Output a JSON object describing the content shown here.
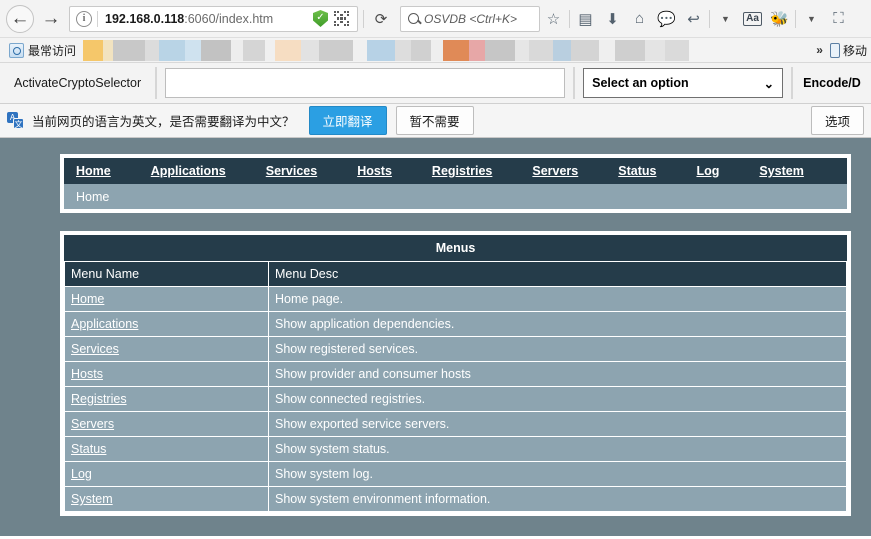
{
  "browser": {
    "nav": {
      "back_icon": "back-arrow-icon",
      "forward_icon": "forward-arrow-icon",
      "info_glyph": "i",
      "url_host": "192.168.0.118",
      "url_rest": ":6060/index.htm",
      "url_full": "192.168.0.118:6060/index.htm",
      "reload_glyph": "⟳",
      "search_placeholder": "OSVDB <Ctrl+K>",
      "icons": [
        "star-icon",
        "reader-list-icon",
        "download-arrow-icon",
        "home-icon",
        "chat-bubble-icon",
        "undo-arrow-icon",
        "chevron-down-icon",
        "font-aa-icon",
        "bug-icon",
        "chevron-down-icon-2",
        "screenshot-crop-icon"
      ]
    },
    "bookmarks": {
      "first_label": "最常访问",
      "overflow_glyph": "»",
      "mobile_label": "移动"
    },
    "addon_bar": {
      "title": "ActivateCryptoSelector",
      "input_value": "",
      "input_placeholder": "",
      "select_value": "Select an option",
      "select_caret": "⌄",
      "right_label": "Encode/D"
    },
    "notification": {
      "icon": "translate-icon",
      "message": "当前网页的语言为英文，是否需要翻译为中文？",
      "translate_now": "立即翻译",
      "not_now": "暂不需要",
      "options": "选项"
    }
  },
  "page": {
    "nav_items": [
      {
        "label": "Home"
      },
      {
        "label": "Applications"
      },
      {
        "label": "Services"
      },
      {
        "label": "Hosts"
      },
      {
        "label": "Registries"
      },
      {
        "label": "Servers"
      },
      {
        "label": "Status"
      },
      {
        "label": "Log"
      },
      {
        "label": "System"
      }
    ],
    "breadcrumb": "Home",
    "table": {
      "title": "Menus",
      "columns": [
        "Menu Name",
        "Menu Desc"
      ],
      "rows": [
        {
          "name": "Home",
          "desc": "Home page."
        },
        {
          "name": "Applications",
          "desc": "Show application dependencies."
        },
        {
          "name": "Services",
          "desc": "Show registered services."
        },
        {
          "name": "Hosts",
          "desc": "Show provider and consumer hosts"
        },
        {
          "name": "Registries",
          "desc": "Show connected registries."
        },
        {
          "name": "Servers",
          "desc": "Show exported service servers."
        },
        {
          "name": "Status",
          "desc": "Show system status."
        },
        {
          "name": "Log",
          "desc": "Show system log."
        },
        {
          "name": "System",
          "desc": "Show system environment information."
        }
      ]
    }
  },
  "colors": {
    "page_background": "#6f838c",
    "header_dark": "#253c4a",
    "row_slate": "#8da4b0",
    "accent_blue": "#2b9fe3"
  }
}
